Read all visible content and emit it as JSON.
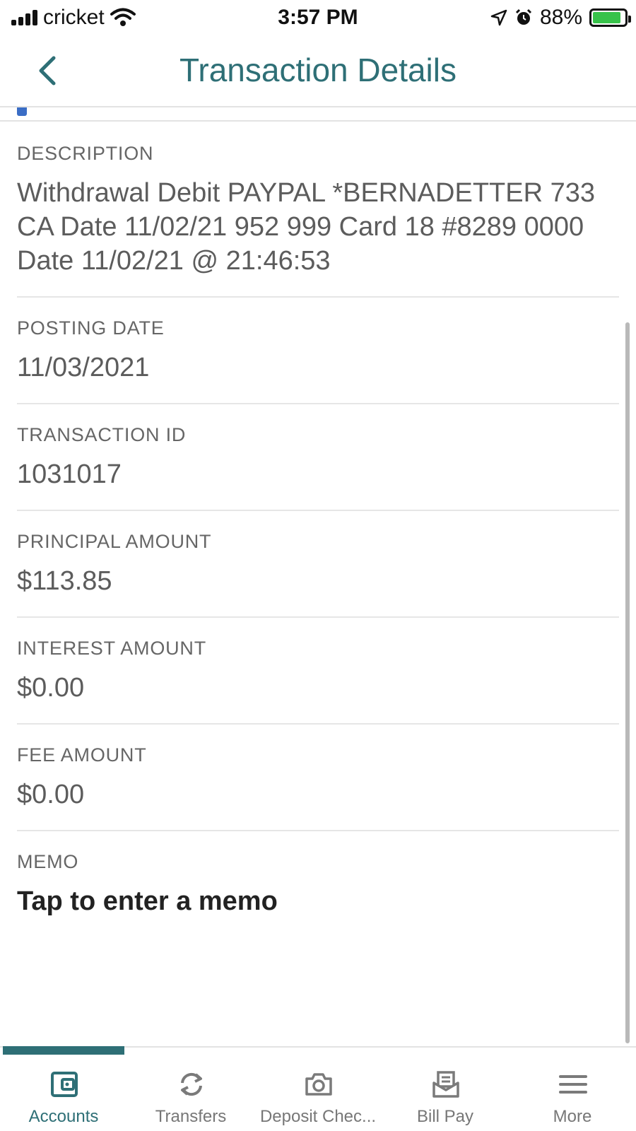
{
  "status_bar": {
    "carrier": "cricket",
    "time": "3:57 PM",
    "battery_percent": "88%",
    "battery_level": 0.88,
    "icons": [
      "signal-icon",
      "wifi-icon",
      "location-icon",
      "alarm-icon",
      "battery-charging-icon"
    ]
  },
  "header": {
    "title": "Transaction Details",
    "back_icon": "chevron-left-icon"
  },
  "fields": {
    "description": {
      "label": "DESCRIPTION",
      "value": "Withdrawal Debit PAYPAL *BERNADETTER 733 CA Date 11/02/21 952 999 Card 18 #8289 0000 Date 11/02/21 @ 21:46:53"
    },
    "posting_date": {
      "label": "POSTING DATE",
      "value": "11/03/2021"
    },
    "transaction_id": {
      "label": "TRANSACTION ID",
      "value": "1031017"
    },
    "principal_amount": {
      "label": "PRINCIPAL AMOUNT",
      "value": "$113.85"
    },
    "interest_amount": {
      "label": "INTEREST AMOUNT",
      "value": "$0.00"
    },
    "fee_amount": {
      "label": "FEE AMOUNT",
      "value": "$0.00"
    },
    "memo": {
      "label": "MEMO",
      "value": "Tap to enter a memo"
    }
  },
  "tabs": [
    {
      "label": "Accounts",
      "icon": "wallet-icon",
      "active": true
    },
    {
      "label": "Transfers",
      "icon": "transfer-arrows-icon",
      "active": false
    },
    {
      "label": "Deposit Chec...",
      "icon": "camera-icon",
      "active": false
    },
    {
      "label": "Bill Pay",
      "icon": "bill-inbox-icon",
      "active": false
    },
    {
      "label": "More",
      "icon": "menu-icon",
      "active": false
    }
  ],
  "colors": {
    "accent": "#2e6f76",
    "battery": "#37c24a"
  }
}
